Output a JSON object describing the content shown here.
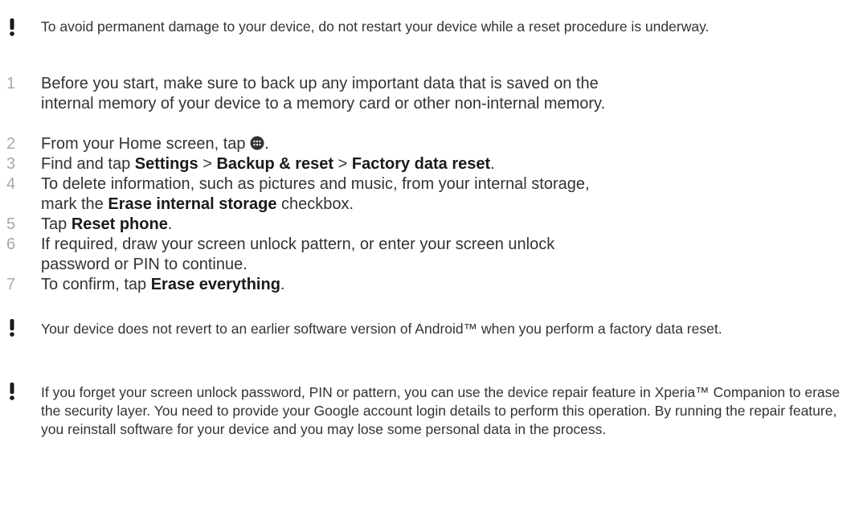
{
  "notes": [
    "To avoid permanent damage to your device, do not restart your device while a reset procedure is underway.",
    "Your device does not revert to an earlier software version of Android™ when you perform a factory data reset.",
    "If you forget your screen unlock password, PIN or pattern, you can use the device repair feature in Xperia™ Companion to erase the security layer. You need to provide your Google account login details to perform this operation. By running the repair feature, you reinstall software for your device and you may lose some personal data in the process."
  ],
  "steps": [
    {
      "num": "1",
      "text": "Before you start, make sure to back up any important data that is saved on the internal memory of your device to a memory card or other non-internal memory."
    },
    {
      "num": "2",
      "before": "From your Home screen, tap ",
      "icon": "apps-grid-icon",
      "after": "."
    },
    {
      "num": "3",
      "t1": "Find and tap ",
      "b1": "Settings",
      "t2": " > ",
      "b2": "Backup & reset",
      "t3": " > ",
      "b3": "Factory data reset",
      "t4": "."
    },
    {
      "num": "4",
      "t1": "To delete information, such as pictures and music, from your internal storage, mark the ",
      "b1": "Erase internal storage",
      "t2": " checkbox."
    },
    {
      "num": "5",
      "t1": "Tap ",
      "b1": "Reset phone",
      "t2": "."
    },
    {
      "num": "6",
      "text": "If required, draw your screen unlock pattern, or enter your screen unlock password or PIN to continue."
    },
    {
      "num": "7",
      "t1": "To confirm, tap ",
      "b1": "Erase everything",
      "t2": "."
    }
  ],
  "icons": {
    "note_mark": "exclamation-icon",
    "apps": "apps-grid-icon"
  }
}
